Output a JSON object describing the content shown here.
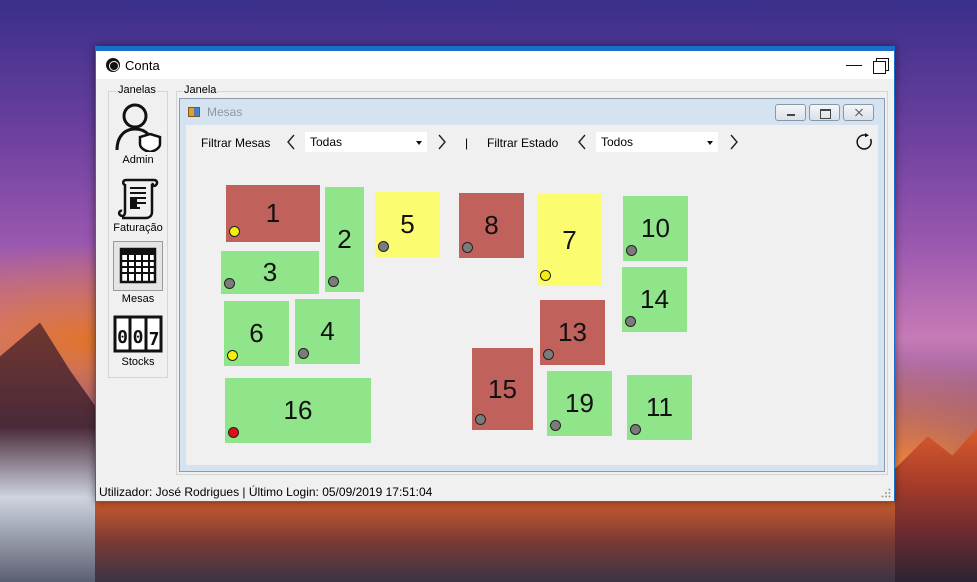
{
  "app": {
    "title": "Conta"
  },
  "sidebar": {
    "group_label": "Janelas",
    "items": [
      {
        "label": "Admin",
        "icon": "admin-user-shield-icon"
      },
      {
        "label": "Faturação",
        "icon": "invoice-scroll-icon"
      },
      {
        "label": "Mesas",
        "icon": "tables-grid-icon",
        "active": true
      },
      {
        "label": "Stocks",
        "icon": "stock-counter-icon"
      }
    ]
  },
  "content_group": {
    "label": "Janela"
  },
  "mesas_window": {
    "title": "Mesas",
    "filter_mesas_label": "Filtrar Mesas",
    "filter_mesas_value": "Todas",
    "separator": "|",
    "filter_estado_label": "Filtrar Estado",
    "filter_estado_value": "Todos"
  },
  "colors": {
    "red": "#c0615c",
    "green": "#90e48a",
    "yellow": "#fcfc70",
    "dot_gray": "#7b7b7b",
    "dot_yellow": "#f5ef10",
    "dot_red": "#e01010"
  },
  "tables": [
    {
      "number": "1",
      "color": "red",
      "dot": "yellow"
    },
    {
      "number": "2",
      "color": "green",
      "dot": "gray"
    },
    {
      "number": "3",
      "color": "green",
      "dot": "gray"
    },
    {
      "number": "4",
      "color": "green",
      "dot": "gray"
    },
    {
      "number": "5",
      "color": "yellow",
      "dot": "gray"
    },
    {
      "number": "6",
      "color": "green",
      "dot": "yellow"
    },
    {
      "number": "7",
      "color": "yellow",
      "dot": "yellow"
    },
    {
      "number": "8",
      "color": "red",
      "dot": "gray"
    },
    {
      "number": "10",
      "color": "green",
      "dot": "gray"
    },
    {
      "number": "11",
      "color": "green",
      "dot": "gray"
    },
    {
      "number": "13",
      "color": "red",
      "dot": "gray"
    },
    {
      "number": "14",
      "color": "green",
      "dot": "gray"
    },
    {
      "number": "15",
      "color": "red",
      "dot": "gray"
    },
    {
      "number": "16",
      "color": "green",
      "dot": "red"
    },
    {
      "number": "19",
      "color": "green",
      "dot": "gray"
    }
  ],
  "status": {
    "text": "Utilizador: José Rodrigues | Último Login: 05/09/2019 17:51:04"
  }
}
